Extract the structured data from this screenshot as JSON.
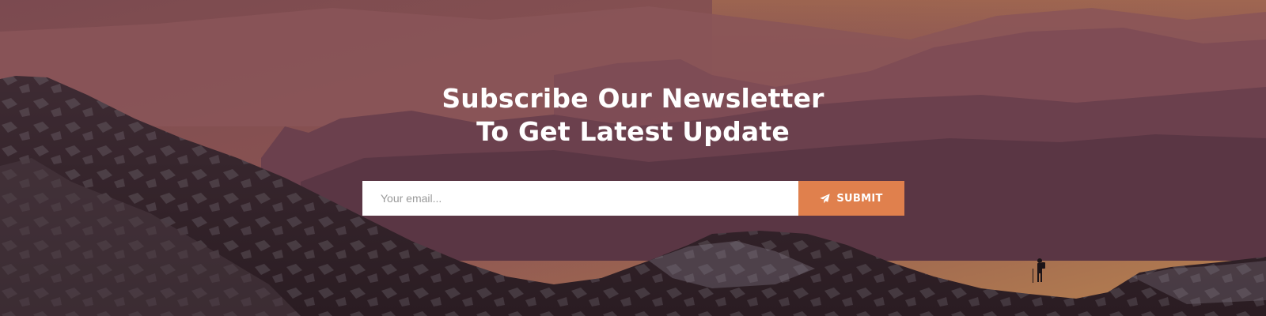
{
  "newsletter": {
    "heading_line1": "Subscribe Our Newsletter",
    "heading_line2": "To Get Latest Update",
    "email_placeholder": "Your email...",
    "submit_label": "SUBMIT",
    "submit_icon": "paper-plane-icon"
  },
  "colors": {
    "accent": "#e0804d",
    "heading_text": "#ffffff",
    "input_background": "#ffffff",
    "sky_top": "#8a5550",
    "sky_warm": "#b07a55"
  }
}
